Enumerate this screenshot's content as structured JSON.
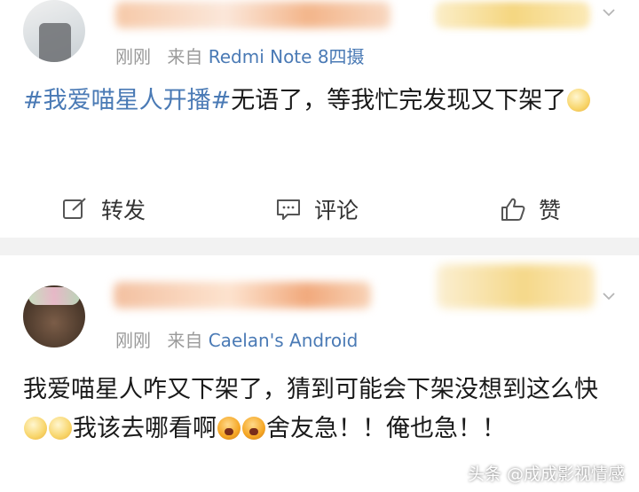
{
  "posts": [
    {
      "time": "刚刚",
      "source_prefix": "来自",
      "device": "Redmi Note 8四摄",
      "topic": "#我爱喵星人开播#",
      "text": "无语了，等我忙完发现又下架了",
      "actions": {
        "repost": "转发",
        "comment": "评论",
        "like": "赞"
      }
    },
    {
      "time": "刚刚",
      "source_prefix": "来自",
      "device": "Caelan's Android",
      "text_a": "我爱喵星人咋又下架了，猜到可能会下架没想到这么快",
      "text_b": "我该去哪看啊",
      "text_c": "舍友急！！俺也急！！"
    }
  ],
  "watermark": "头条 @成成影视情感",
  "icons": {
    "more": "chevron-down-icon",
    "repost": "edit-share-icon",
    "comment": "comment-icon",
    "like": "thumbs-up-icon"
  }
}
